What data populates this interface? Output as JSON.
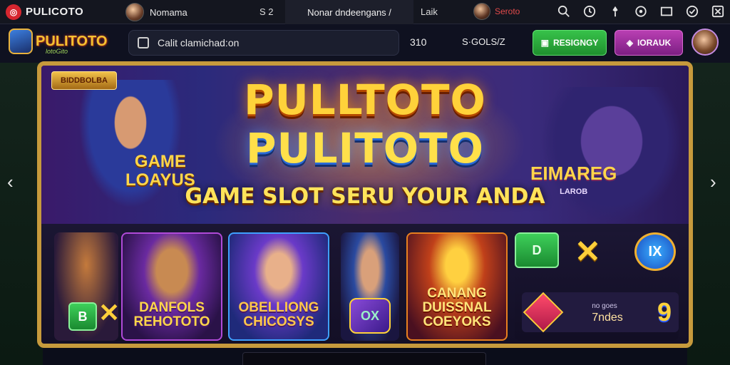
{
  "topbar": {
    "logo_text": "PULICOTO",
    "user_name": "Nomama",
    "price": "S 2",
    "center_text": "Nonar dndeengans /",
    "link": "Laik",
    "user2_name": "Seroto"
  },
  "header": {
    "brand": "PULITOTO",
    "brand_sub": "lotoGito",
    "search_text": "Calit clamichad:on",
    "value1": "310",
    "value2": "S·GOLS/Z",
    "green_button": "RESIGNGY",
    "purple_button": "IORAUK"
  },
  "banner": {
    "badge": "BIDDBOLBA",
    "title1": "PULLTOTO",
    "title2": "PULITOTO",
    "tagline": "GAME SLOT SERU YOUR ANDA",
    "left_caption_1": "GAME",
    "left_caption_2": "LOAYUS",
    "right_caption": "EIMAREG",
    "right_small": "LAROB"
  },
  "tiles": {
    "t2_label_1": "DANFOLS",
    "t2_label_2": "REHOTOTO",
    "t3_label_1": "OBELLIONG",
    "t3_label_2": "CHICOSYS",
    "t5_label_1": "CANANG",
    "t5_label_2": "DUISSNAL",
    "t5_label_3": "COEYOKS",
    "chip_green": "D",
    "chip_blue": "IX",
    "ndeals_top": "no goes",
    "ndeals_main": "7ndes",
    "nine": "9",
    "mini_green": "B",
    "gem_ox": "OX"
  }
}
